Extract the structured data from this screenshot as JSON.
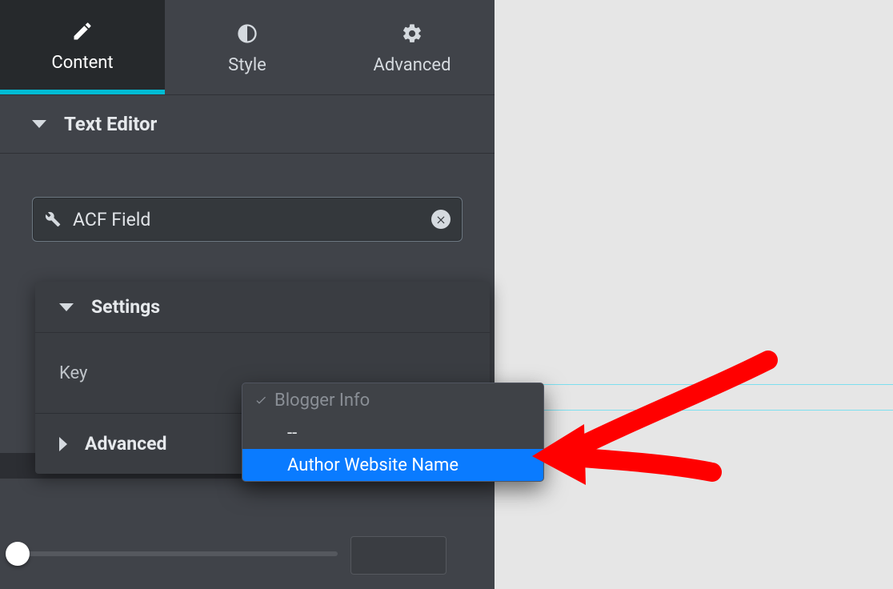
{
  "tabs": {
    "content": "Content",
    "style": "Style",
    "advanced": "Advanced"
  },
  "section": {
    "text_editor": "Text Editor"
  },
  "dynamic_tag": {
    "label": "ACF Field"
  },
  "popup": {
    "settings": "Settings",
    "key_label": "Key",
    "advanced": "Advanced"
  },
  "dropdown": {
    "group": "Blogger Info",
    "items": [
      "--",
      "Author Website Name"
    ],
    "selected": "Author Website Name"
  }
}
